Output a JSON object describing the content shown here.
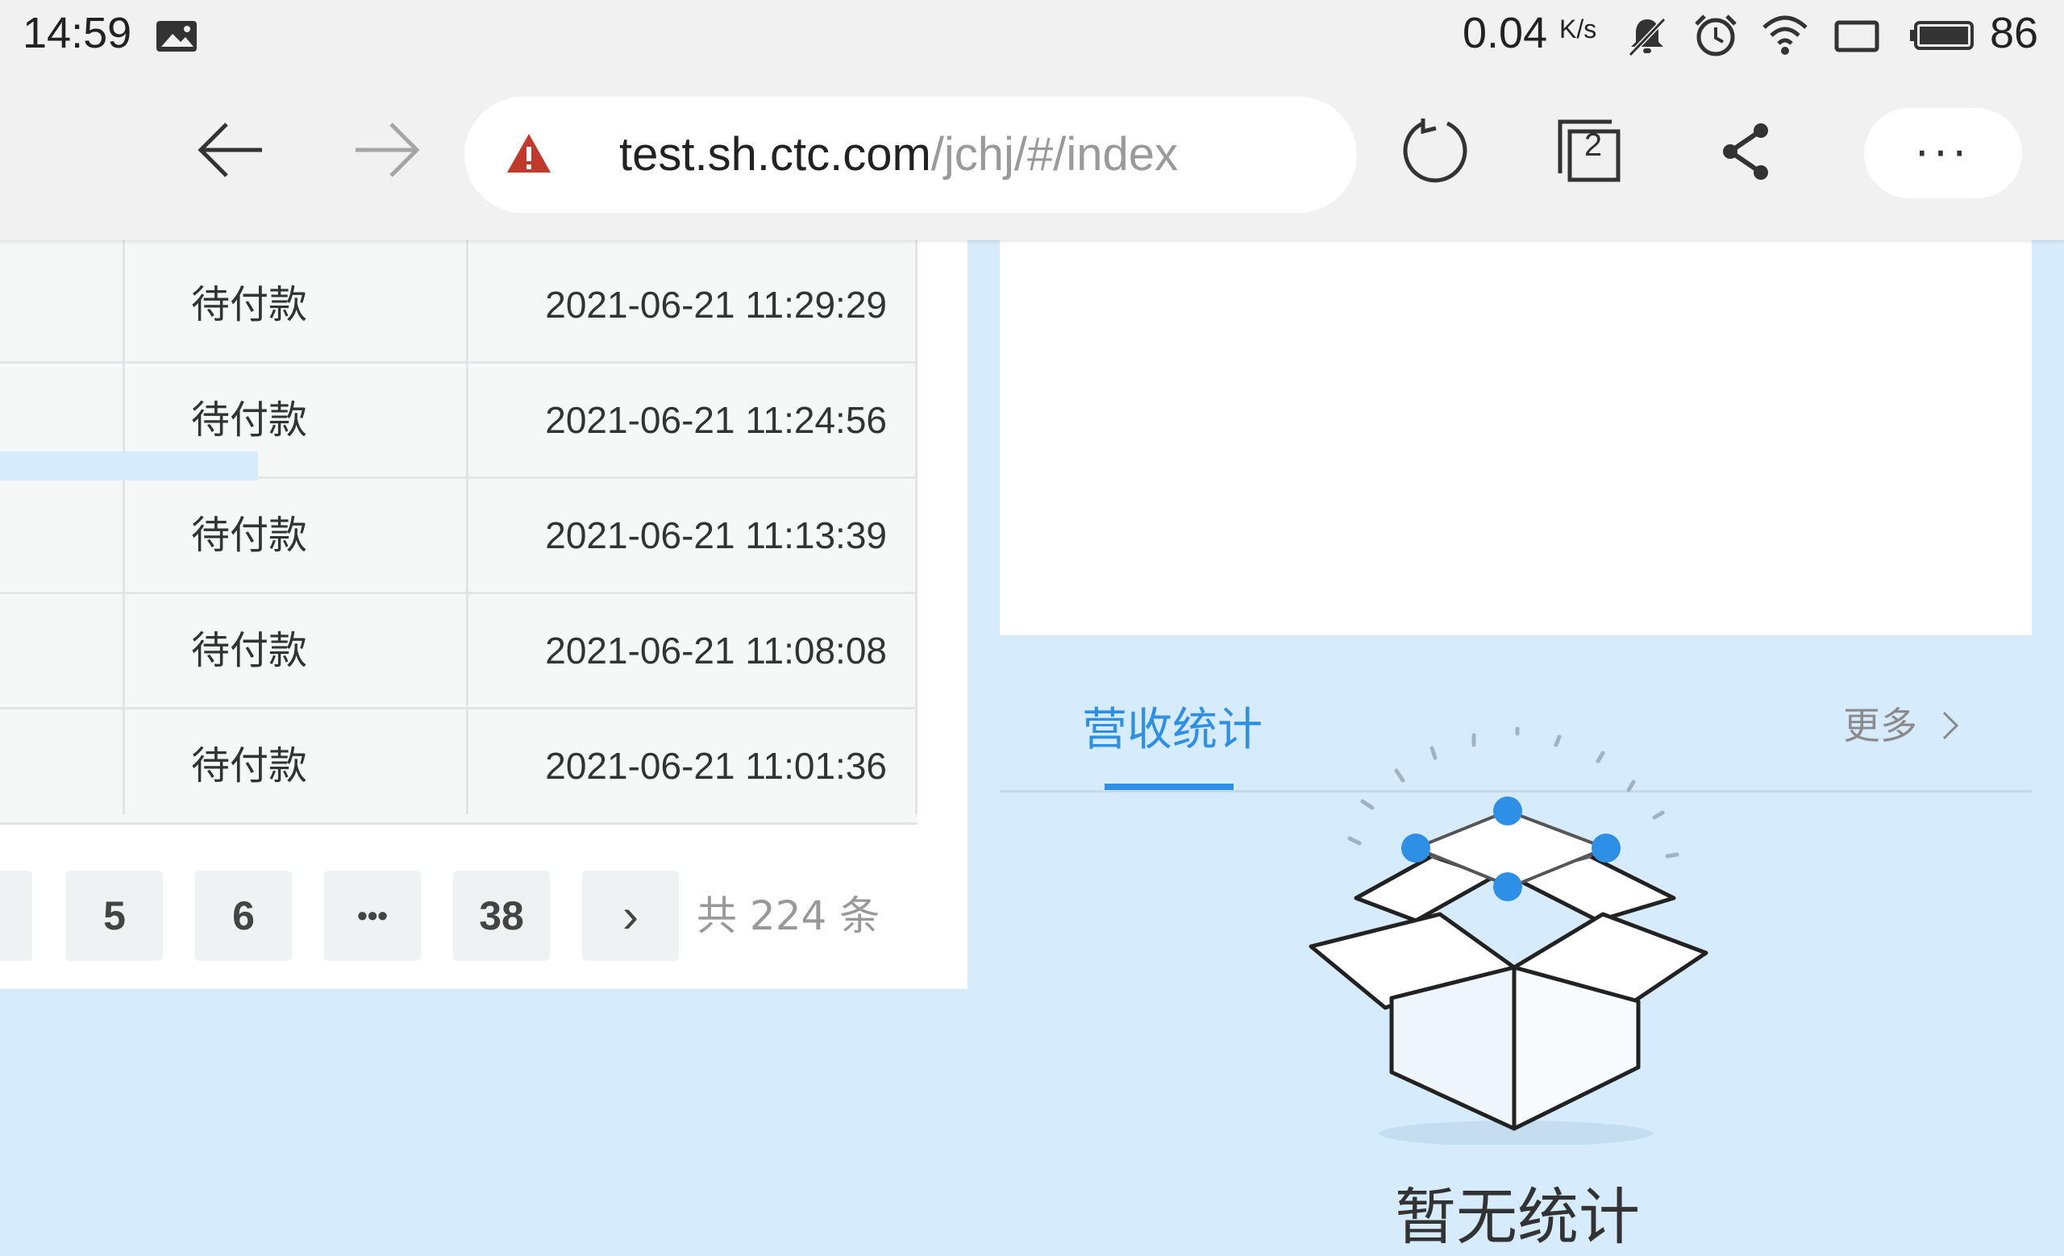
{
  "status_bar": {
    "time": "14:59",
    "net_speed": "0.04",
    "net_speed_unit": "K/s",
    "battery": "86",
    "icons": [
      "gallery-icon",
      "mute-icon",
      "alarm-icon",
      "wifi-icon",
      "screen-rotate-icon",
      "battery-icon"
    ]
  },
  "browser": {
    "url_host": "test.sh.ctc.com",
    "url_path": "/jchj/#/index",
    "tab_count": "2",
    "more_label": "···",
    "warning_color": "#c0392b"
  },
  "table": {
    "rows": [
      {
        "status": "待付款",
        "time": "2021-06-21 11:29:29"
      },
      {
        "status": "待付款",
        "time": "2021-06-21 11:24:56"
      },
      {
        "status": "待付款",
        "time": "2021-06-21 11:13:39"
      },
      {
        "status": "待付款",
        "time": "2021-06-21 11:08:08"
      },
      {
        "status": "待付款",
        "time": "2021-06-21 11:01:36"
      }
    ]
  },
  "pagination": {
    "pages": [
      "5",
      "6",
      "•••",
      "38"
    ],
    "next": "›",
    "total_text": "共 224 条"
  },
  "revenue": {
    "tab_label": "营收统计",
    "more_label": "更多",
    "empty_label": "暂无统计",
    "accent_color": "#2e8fe6"
  }
}
